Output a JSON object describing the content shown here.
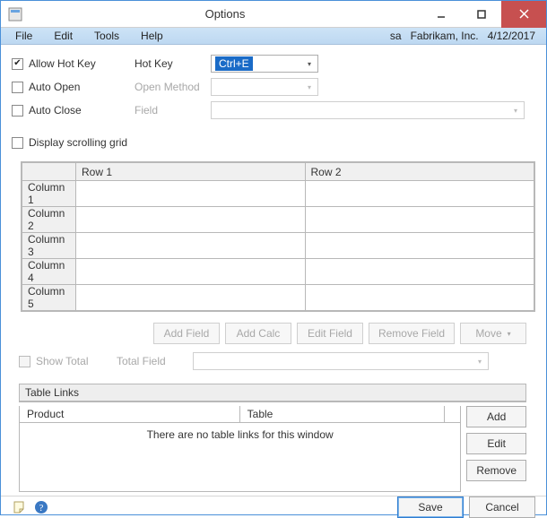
{
  "window": {
    "title": "Options"
  },
  "menu": {
    "items": [
      "File",
      "Edit",
      "Tools",
      "Help"
    ],
    "user": "sa",
    "company": "Fabrikam, Inc.",
    "date": "4/12/2017"
  },
  "options": {
    "allow_hot_key": {
      "label": "Allow Hot Key",
      "checked": true
    },
    "hot_key": {
      "label": "Hot Key",
      "value": "Ctrl+E"
    },
    "auto_open": {
      "label": "Auto Open",
      "checked": false
    },
    "open_method": {
      "label": "Open Method"
    },
    "auto_close": {
      "label": "Auto Close",
      "checked": false
    },
    "field": {
      "label": "Field"
    },
    "display_scrolling_grid": {
      "label": "Display scrolling grid",
      "checked": false
    }
  },
  "grid": {
    "col_headers": [
      "Row 1",
      "Row 2"
    ],
    "row_headers": [
      "Column 1",
      "Column 2",
      "Column 3",
      "Column 4",
      "Column 5"
    ]
  },
  "grid_buttons": {
    "add_field": "Add Field",
    "add_calc": "Add Calc",
    "edit_field": "Edit Field",
    "remove_field": "Remove Field",
    "move": "Move"
  },
  "total": {
    "show_total": {
      "label": "Show Total",
      "checked": false
    },
    "total_field": {
      "label": "Total Field"
    }
  },
  "links": {
    "header": "Table Links",
    "col_product": "Product",
    "col_table": "Table",
    "empty_msg": "There are no table links for this window",
    "buttons": {
      "add": "Add",
      "edit": "Edit",
      "remove": "Remove"
    }
  },
  "footer": {
    "save": "Save",
    "cancel": "Cancel"
  }
}
